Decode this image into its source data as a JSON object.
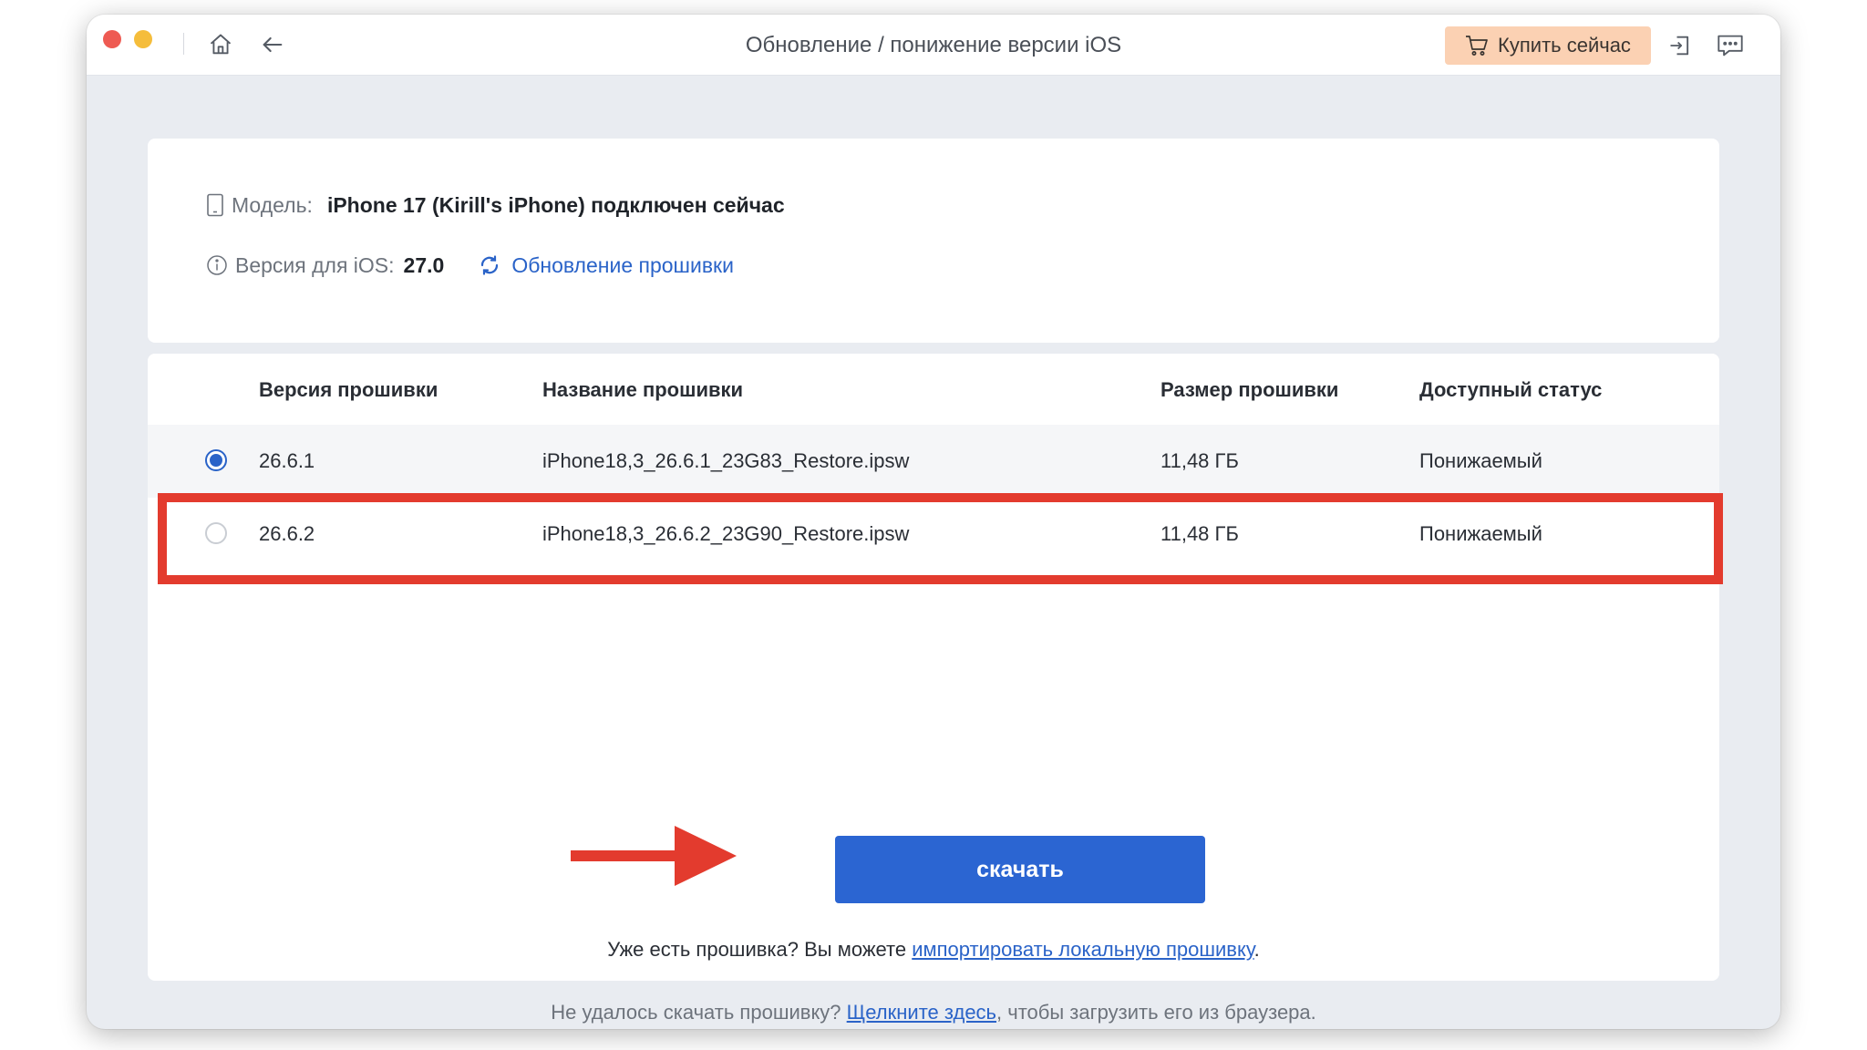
{
  "window": {
    "title": "Обновление / понижение версии iOS",
    "buy_label": "Купить сейчас"
  },
  "device": {
    "model_label": "Модель:",
    "model_value": "iPhone 17 (Kirill's iPhone) подключен сейчас",
    "version_label": "Версия для iOS:",
    "version_value": "27.0",
    "firmware_update_link": "Обновление прошивки"
  },
  "table": {
    "headers": [
      "Версия прошивки",
      "Название прошивки",
      "Размер прошивки",
      "Доступный статус"
    ],
    "rows": [
      {
        "version": "26.6.1",
        "name": "iPhone18,3_26.6.1_23G83_Restore.ipsw",
        "size": "11,48 ГБ",
        "status": "Понижаемый",
        "selected": true
      },
      {
        "version": "26.6.2",
        "name": "iPhone18,3_26.6.2_23G90_Restore.ipsw",
        "size": "11,48 ГБ",
        "status": "Понижаемый",
        "selected": false
      }
    ]
  },
  "download_label": "скачать",
  "import": {
    "prefix": "Уже есть прошивка? Вы можете ",
    "link": "импортировать локальную прошивку",
    "suffix": "."
  },
  "footer": {
    "prefix": "Не удалось скачать прошивку? ",
    "link": "Щелкните здесь",
    "suffix": ", чтобы загрузить его из браузера."
  },
  "colors": {
    "accent": "#2b65d2",
    "buy_button": "#fbd1b3",
    "annotation_red": "#e33b2e"
  },
  "icons": [
    "home-icon",
    "back-arrow-icon",
    "cart-icon",
    "login-icon",
    "feedback-icon",
    "phone-icon",
    "info-icon",
    "refresh-icon"
  ]
}
